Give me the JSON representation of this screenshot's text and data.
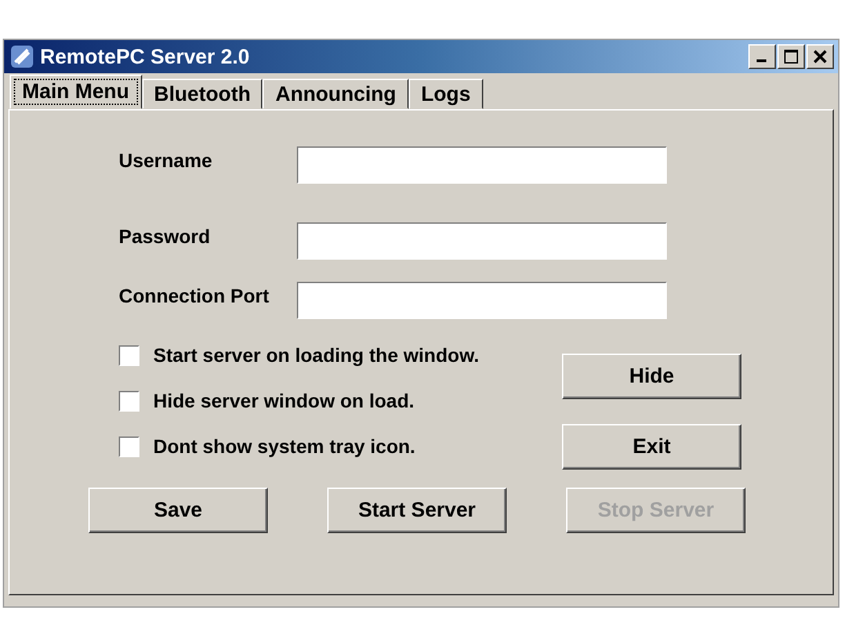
{
  "window": {
    "title": "RemotePC Server 2.0"
  },
  "tabs": [
    {
      "label": "Main Menu",
      "selected": true
    },
    {
      "label": "Bluetooth",
      "selected": false
    },
    {
      "label": "Announcing",
      "selected": false
    },
    {
      "label": "Logs",
      "selected": false
    }
  ],
  "fields": [
    {
      "label": "Username"
    },
    {
      "label": "Password"
    },
    {
      "label": "Connection Port"
    }
  ],
  "options": [
    {
      "label": "Start server on loading the window.",
      "checked": false
    },
    {
      "label": "Hide server window on load.",
      "checked": false
    },
    {
      "label": "Dont show system tray icon.",
      "checked": false
    }
  ],
  "side_buttons": [
    {
      "label": "Hide",
      "disabled": false
    },
    {
      "label": "Exit",
      "disabled": false
    }
  ],
  "bottom_buttons": [
    {
      "label": "Save",
      "disabled": false
    },
    {
      "label": "Start Server",
      "disabled": false
    },
    {
      "label": "Stop Server",
      "disabled": true
    }
  ]
}
